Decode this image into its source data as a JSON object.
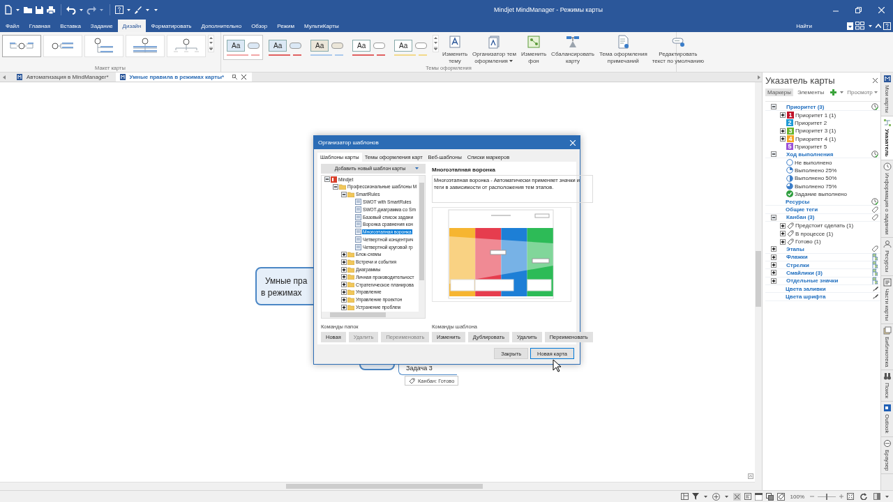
{
  "window": {
    "title": "Mindjet MindManager - Режимы карты"
  },
  "menu": {
    "tabs": [
      {
        "label": "Файл",
        "selected": false
      },
      {
        "label": "Главная",
        "selected": false
      },
      {
        "label": "Вставка",
        "selected": false
      },
      {
        "label": "Задание",
        "selected": false
      },
      {
        "label": "Дизайн",
        "selected": true
      },
      {
        "label": "Форматировать",
        "selected": false
      },
      {
        "label": "Дополнительно",
        "selected": false
      },
      {
        "label": "Обзор",
        "selected": false
      },
      {
        "label": "Режим",
        "selected": false
      },
      {
        "label": "МультиКарты",
        "selected": false
      }
    ],
    "search": "Найти"
  },
  "ribbon": {
    "layouts": [
      {
        "kind": "map",
        "selected": true
      },
      {
        "kind": "right",
        "selected": false
      },
      {
        "kind": "org",
        "selected": false
      },
      {
        "kind": "tree",
        "selected": false
      },
      {
        "kind": "timeline",
        "selected": false
      }
    ],
    "layout_group": "Макет карты",
    "themes": [
      {
        "sample": "Aa",
        "kind": "tinted",
        "color": "#f2a6a6",
        "selected": true
      },
      {
        "sample": "Aa",
        "kind": "tinted",
        "color": "#e06060",
        "selected": false
      },
      {
        "sample": "Aa",
        "kind": "beige",
        "color": "#a9c8ec",
        "selected": false
      },
      {
        "sample": "Aa",
        "kind": "plain",
        "color": "#e06060",
        "selected": false
      },
      {
        "sample": "Aa",
        "kind": "plain",
        "color": "#f2d98a",
        "selected": false
      }
    ],
    "buttons": [
      {
        "label": "Изменить\nтему",
        "dropdown": false
      },
      {
        "label": "Организатор тем\nоформления",
        "dropdown": true
      },
      {
        "label": "Изменить\nфон",
        "dropdown": false
      },
      {
        "label": "Сбалансировать\nкарту",
        "dropdown": false
      },
      {
        "label": "Тема оформления\nпримечаний",
        "dropdown": false
      },
      {
        "label": "Редактировать\nтекст по умолчанию",
        "dropdown": false
      }
    ],
    "theme_group": "Темы оформления"
  },
  "doc_tabs": [
    {
      "label": "Автоматизация в MindManager*",
      "selected": false
    },
    {
      "label": "Умные правила в режимах карты*",
      "selected": true
    }
  ],
  "map": {
    "central": {
      "lines": [
        "Умные пра",
        "в режимах"
      ]
    },
    "subtopic": "Задача 3",
    "tag": "Канбан: Готово"
  },
  "dialog": {
    "title": "Организатор шаблонов",
    "tabs": [
      {
        "label": "Шаблоны карты",
        "selected": true
      },
      {
        "label": "Темы оформления карт",
        "selected": false
      },
      {
        "label": "Веб-шаблоны",
        "selected": false
      },
      {
        "label": "Списки маркеров",
        "selected": false
      }
    ],
    "add_button": "Добавить новый шаблон карты",
    "tree": [
      {
        "label": "Mindjet",
        "kind": "root",
        "expanded": true,
        "selected": false,
        "children": [
          {
            "label": "Профессиональные шаблоны M",
            "kind": "folder",
            "expanded": true,
            "selected": false,
            "children": [
              {
                "label": "SmartRules",
                "kind": "folder",
                "expanded": true,
                "selected": false,
                "children": [
                  {
                    "label": "SWOT with SmartRules",
                    "kind": "template",
                    "selected": false
                  },
                  {
                    "label": "SWOT-диаграмма со Sm",
                    "kind": "template",
                    "selected": false
                  },
                  {
                    "label": "Базовый список задани",
                    "kind": "template",
                    "selected": false
                  },
                  {
                    "label": "Воронка сравнения кон",
                    "kind": "template",
                    "selected": false
                  },
                  {
                    "label": "Многоэтапная воронка",
                    "kind": "template",
                    "selected": true
                  },
                  {
                    "label": "Четвертной концентрич",
                    "kind": "template",
                    "selected": false
                  },
                  {
                    "label": "Четвертной круговой гр",
                    "kind": "template",
                    "selected": false
                  }
                ]
              },
              {
                "label": "Блок-схемы",
                "kind": "folder",
                "expanded": false,
                "selected": false
              },
              {
                "label": "Встречи и события",
                "kind": "folder",
                "expanded": false,
                "selected": false
              },
              {
                "label": "Диаграммы",
                "kind": "folder",
                "expanded": false,
                "selected": false
              },
              {
                "label": "Личная производительност",
                "kind": "folder",
                "expanded": false,
                "selected": false
              },
              {
                "label": "Стратегическое планирова",
                "kind": "folder",
                "expanded": false,
                "selected": false
              },
              {
                "label": "Управление",
                "kind": "folder",
                "expanded": false,
                "selected": false
              },
              {
                "label": "Управление проектон",
                "kind": "folder",
                "expanded": false,
                "selected": false
              },
              {
                "label": "Устранение проблем",
                "kind": "folder",
                "expanded": false,
                "selected": false
              }
            ]
          }
        ]
      }
    ],
    "template_title": "Многоэтапная воронка",
    "description": "Многоэтапная воронка - Автоматически применяет значки и теги в зависимости от расположения тем этапов.",
    "folder_commands_label": "Команды папок",
    "folder_commands": [
      {
        "label": "Новая",
        "disabled": false
      },
      {
        "label": "Удалить",
        "disabled": true
      },
      {
        "label": "Переименовать",
        "disabled": true
      }
    ],
    "template_commands_label": "Команды шаблона",
    "template_commands": [
      {
        "label": "Изменить",
        "disabled": false
      },
      {
        "label": "Дублировать",
        "disabled": false
      },
      {
        "label": "Удалить",
        "disabled": false
      },
      {
        "label": "Переименовать",
        "disabled": false
      }
    ],
    "footer_buttons": [
      {
        "label": "Закрыть",
        "default": false
      },
      {
        "label": "Новая карта",
        "default": true
      }
    ]
  },
  "map_index": {
    "title": "Указатель карты",
    "tabs": [
      {
        "label": "Маркеры",
        "selected": true
      },
      {
        "label": "Элементы",
        "selected": false
      }
    ],
    "view": "Просмотр",
    "groups": [
      {
        "label": "Приоритет (3)",
        "expanded": true,
        "kind": "icons",
        "children": [
          {
            "label": "Приоритет 1 (1)",
            "expanded": false,
            "kind": "priority",
            "badge": "1",
            "color": "#c0142a"
          },
          {
            "label": "Приоритет 2",
            "kind": "priority",
            "badge": "2",
            "color": "#1f9ad6"
          },
          {
            "label": "Приоритет 3 (1)",
            "expanded": false,
            "kind": "priority",
            "badge": "3",
            "color": "#6ab42d"
          },
          {
            "label": "Приоритет 4 (1)",
            "expanded": false,
            "kind": "priority",
            "badge": "4",
            "color": "#f5a623"
          },
          {
            "label": "Приоритет 5",
            "kind": "priority",
            "badge": "5",
            "color": "#9b51d6"
          }
        ]
      },
      {
        "label": "Ход выполнения",
        "expanded": true,
        "kind": "icons",
        "children": [
          {
            "label": "Не выполнено",
            "kind": "not-started"
          },
          {
            "label": "Выполнено 25%",
            "kind": "quarter"
          },
          {
            "label": "Выполнено 50%",
            "kind": "half"
          },
          {
            "label": "Выполнено 75%",
            "kind": "three-quarters"
          },
          {
            "label": "Задание выполнено",
            "kind": "done"
          }
        ]
      },
      {
        "label": "Ресурсы",
        "kind": "icons"
      },
      {
        "label": "Общие теги",
        "kind": "tags"
      },
      {
        "label": "Канбан (3)",
        "expanded": true,
        "kind": "tags",
        "children": [
          {
            "label": "Предстоит сделать (1)",
            "expanded": false,
            "kind": "tag"
          },
          {
            "label": "В процессе (1)",
            "expanded": false,
            "kind": "tag"
          },
          {
            "label": "Готово (1)",
            "expanded": false,
            "kind": "tag"
          }
        ]
      },
      {
        "label": "Этапы",
        "expanded": false,
        "kind": "tags"
      },
      {
        "label": "Флажки",
        "expanded": false,
        "kind": "flags"
      },
      {
        "label": "Стрелки",
        "expanded": false,
        "kind": "flags"
      },
      {
        "label": "Смайлики (3)",
        "expanded": false,
        "kind": "flags"
      },
      {
        "label": "Отдельные значки",
        "expanded": false,
        "kind": "flags"
      },
      {
        "label": "Цвета заливки",
        "kind": "format"
      },
      {
        "label": "Цвета шрифта",
        "kind": "format"
      }
    ]
  },
  "side_tabs": [
    {
      "label": "Мои карты",
      "selected": false
    },
    {
      "label": "Указатель",
      "selected": true
    },
    {
      "label": "Информация о задании",
      "selected": false
    },
    {
      "label": "Ресурсы",
      "selected": false
    },
    {
      "label": "Части карты",
      "selected": false
    },
    {
      "label": "Библиотека",
      "selected": false
    },
    {
      "label": "Поиск",
      "selected": false
    },
    {
      "label": "Outlook",
      "selected": false
    },
    {
      "label": "Браузер",
      "selected": false
    }
  ],
  "status_bar": {
    "zoom": {
      "reading": "100%",
      "level": 0.5
    }
  }
}
